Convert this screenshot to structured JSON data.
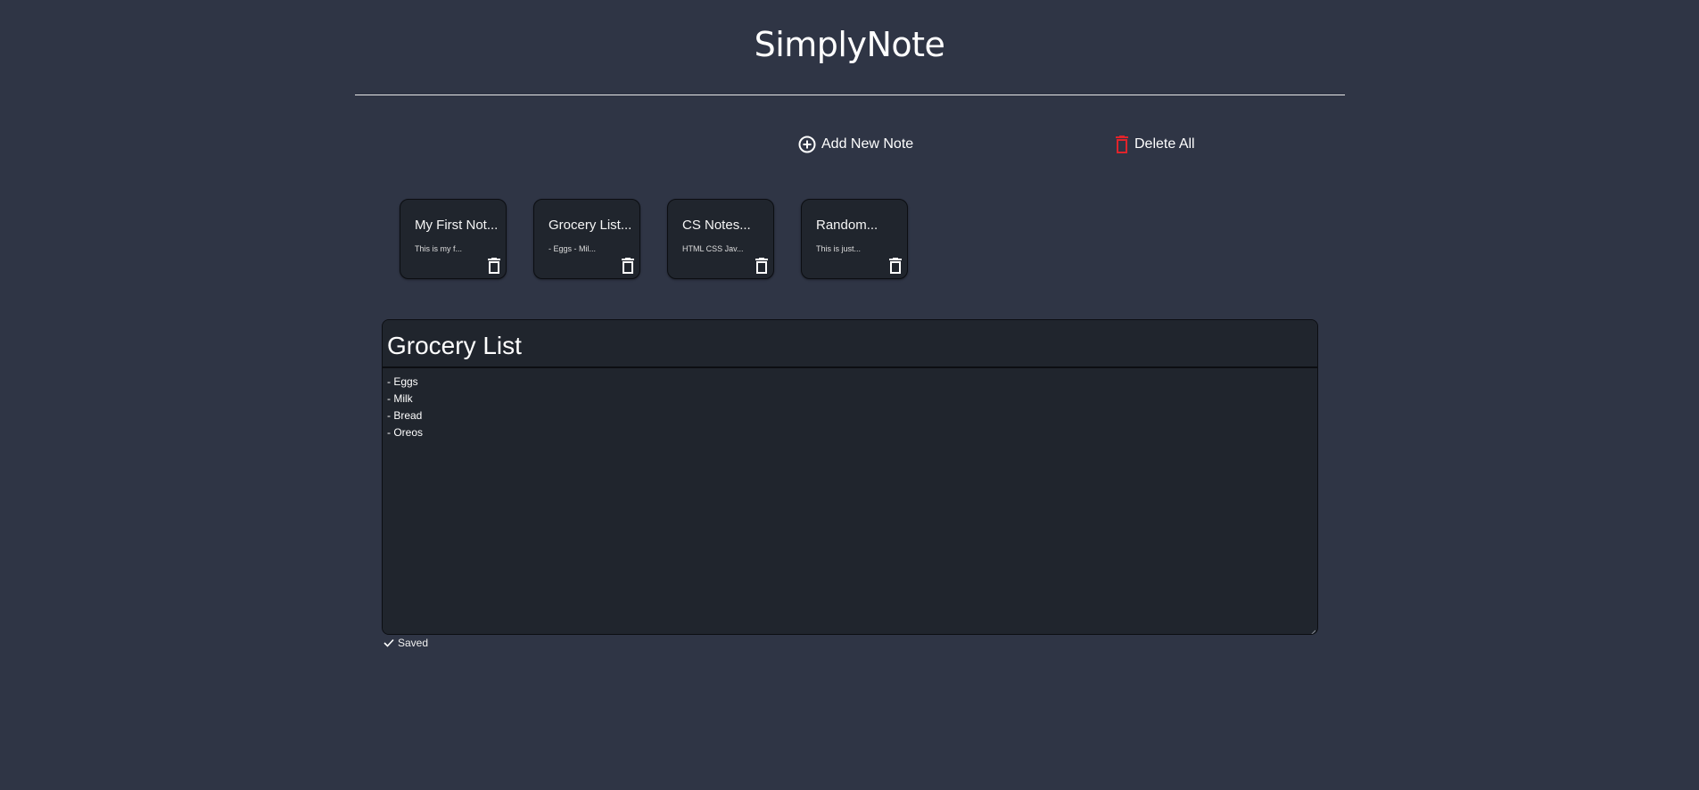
{
  "app": {
    "title": "SimplyNote"
  },
  "toolbar": {
    "add_label": "Add New Note",
    "add_icon": "plus-circle-icon",
    "delete_all_label": "Delete All",
    "delete_all_icon": "trash-icon",
    "delete_all_color": "#e0242b"
  },
  "notes": [
    {
      "title": "My First Not...",
      "preview": "This is my f..."
    },
    {
      "title": "Grocery List...",
      "preview": "- Eggs - Mil..."
    },
    {
      "title": "CS Notes...",
      "preview": "HTML CSS Jav..."
    },
    {
      "title": "Random...",
      "preview": "This is just..."
    }
  ],
  "editor": {
    "title": "Grocery List",
    "body": "- Eggs\n- Milk\n- Bread\n- Oreos"
  },
  "status": {
    "label": "Saved",
    "icon": "checkmark-icon"
  },
  "colors": {
    "background": "#2f3545",
    "card": "#20252d",
    "text": "#ffffff",
    "danger": "#e0242b"
  }
}
